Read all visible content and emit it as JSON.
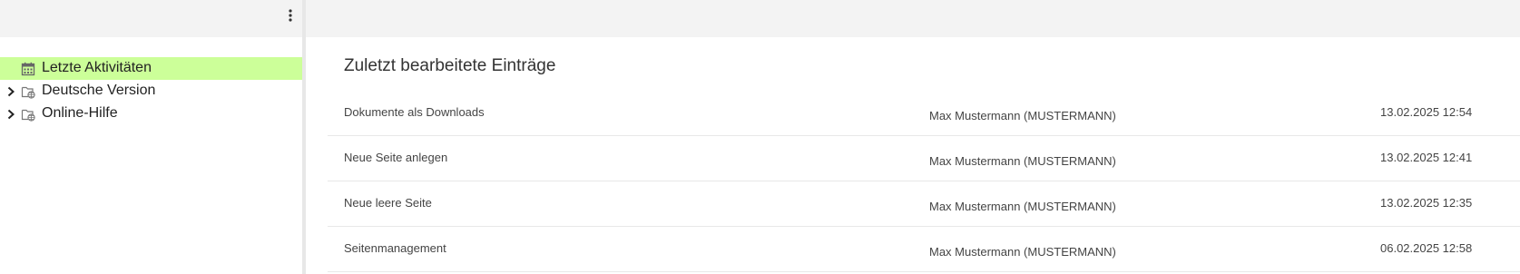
{
  "sidebar": {
    "menu_icon": "more-vertical-icon",
    "tree": [
      {
        "label": "Letzte Aktivitäten",
        "icon": "calendar-icon",
        "active": true
      },
      {
        "label": "Deutsche Version",
        "icon": "folder-globe-icon",
        "expandable": true
      },
      {
        "label": "Online-Hilfe",
        "icon": "folder-globe-icon",
        "expandable": true
      }
    ]
  },
  "main": {
    "title": "Zuletzt bearbeitete Einträge",
    "entries": [
      {
        "title": "Dokumente als Downloads",
        "user": "Max Mustermann (MUSTERMANN)",
        "date": "13.02.2025 12:54"
      },
      {
        "title": "Neue Seite anlegen",
        "user": "Max Mustermann (MUSTERMANN)",
        "date": "13.02.2025 12:41"
      },
      {
        "title": "Neue leere Seite",
        "user": "Max Mustermann (MUSTERMANN)",
        "date": "13.02.2025 12:35"
      },
      {
        "title": "Seitenmanagement",
        "user": "Max Mustermann (MUSTERMANN)",
        "date": "06.02.2025 12:58"
      }
    ]
  },
  "colors": {
    "active_item_bg": "#ccff99",
    "topbar_bg": "#f3f3f3",
    "divider": "#e8e8e8"
  }
}
